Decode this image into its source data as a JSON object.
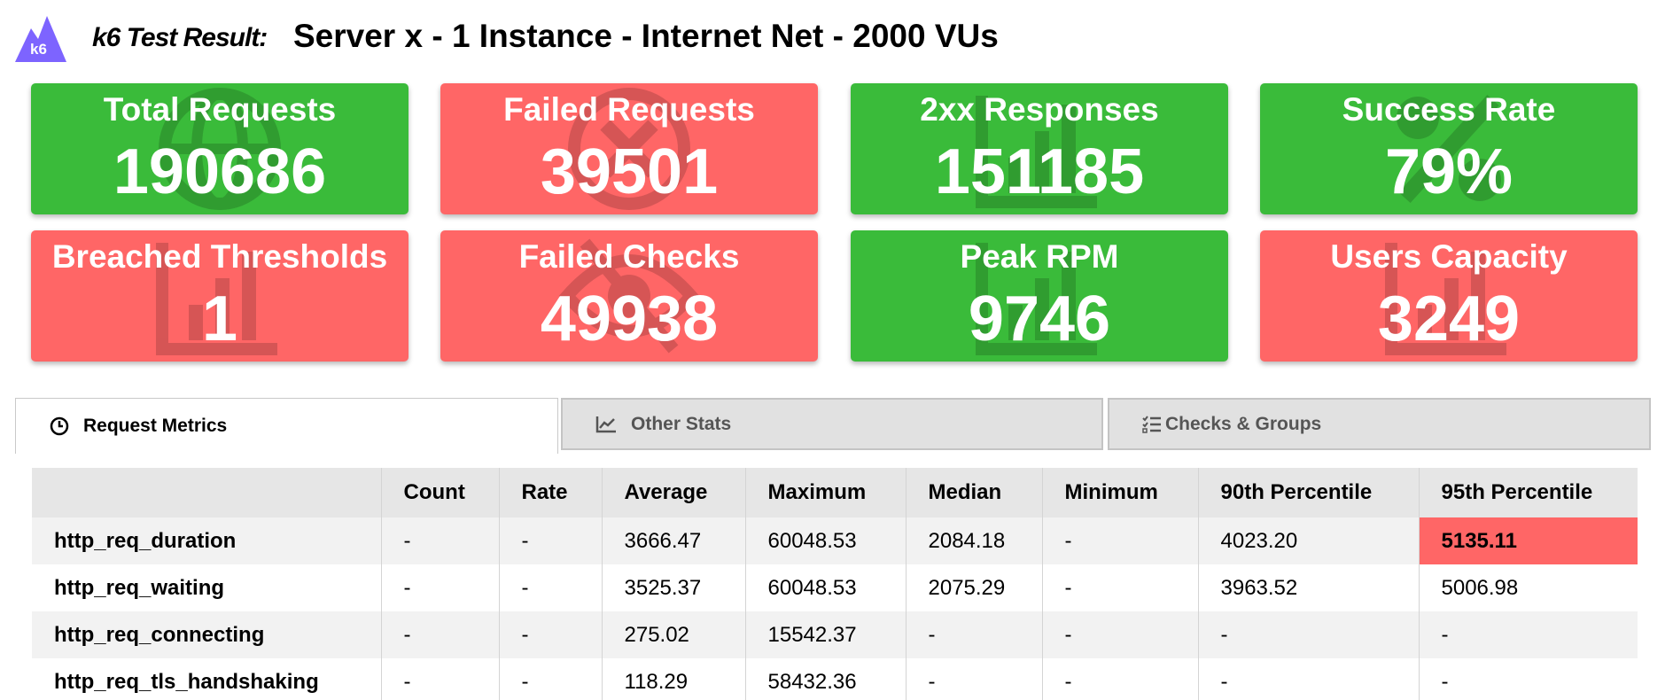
{
  "header": {
    "logo_text": "k6",
    "report_label": "k6 Test Result:",
    "title": "Server x - 1 Instance - Internet Net - 2000 VUs"
  },
  "colors": {
    "good": "#3abb3a",
    "bad": "#ff6666",
    "brand": "#7d64ff"
  },
  "stats": [
    {
      "label": "Total Requests",
      "value": "190686",
      "status": "good",
      "icon": "globe-icon"
    },
    {
      "label": "Failed Requests",
      "value": "39501",
      "status": "bad",
      "icon": "times-circle-icon"
    },
    {
      "label": "2xx Responses",
      "value": "151185",
      "status": "good",
      "icon": "bar-chart-icon"
    },
    {
      "label": "Success Rate",
      "value": "79%",
      "status": "good",
      "icon": "percent-icon"
    },
    {
      "label": "Breached Thresholds",
      "value": "1",
      "status": "bad",
      "icon": "bar-chart-icon"
    },
    {
      "label": "Failed Checks",
      "value": "49938",
      "status": "bad",
      "icon": "eye-slash-icon"
    },
    {
      "label": "Peak RPM",
      "value": "9746",
      "status": "good",
      "icon": "bar-chart-icon"
    },
    {
      "label": "Users Capacity",
      "value": "3249",
      "status": "bad",
      "icon": "bar-chart-icon"
    }
  ],
  "tabs": [
    {
      "label": "Request Metrics",
      "icon": "clock-icon",
      "active": true
    },
    {
      "label": "Other Stats",
      "icon": "line-chart-icon",
      "active": false
    },
    {
      "label": "Checks & Groups",
      "icon": "checklist-icon",
      "active": false
    }
  ],
  "table": {
    "columns": [
      "",
      "Count",
      "Rate",
      "Average",
      "Maximum",
      "Median",
      "Minimum",
      "90th Percentile",
      "95th Percentile"
    ],
    "rows": [
      [
        "http_req_duration",
        "-",
        "-",
        "3666.47",
        "60048.53",
        "2084.18",
        "-",
        "4023.20",
        "5135.11"
      ],
      [
        "http_req_waiting",
        "-",
        "-",
        "3525.37",
        "60048.53",
        "2075.29",
        "-",
        "3963.52",
        "5006.98"
      ],
      [
        "http_req_connecting",
        "-",
        "-",
        "275.02",
        "15542.37",
        "-",
        "-",
        "-",
        "-"
      ],
      [
        "http_req_tls_handshaking",
        "-",
        "-",
        "118.29",
        "58432.36",
        "-",
        "-",
        "-",
        "-"
      ]
    ]
  }
}
